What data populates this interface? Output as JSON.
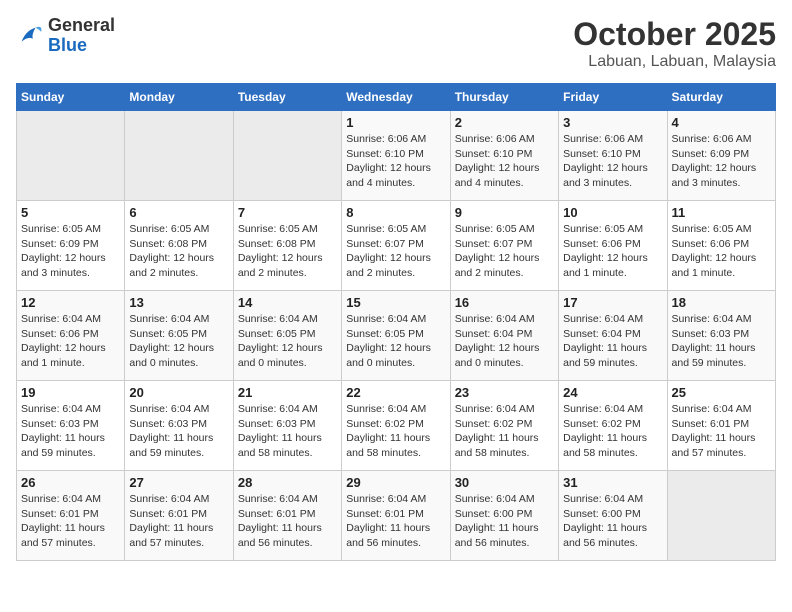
{
  "header": {
    "logo_general": "General",
    "logo_blue": "Blue",
    "month": "October 2025",
    "location": "Labuan, Labuan, Malaysia"
  },
  "days_of_week": [
    "Sunday",
    "Monday",
    "Tuesday",
    "Wednesday",
    "Thursday",
    "Friday",
    "Saturday"
  ],
  "weeks": [
    [
      {
        "day": "",
        "info": ""
      },
      {
        "day": "",
        "info": ""
      },
      {
        "day": "",
        "info": ""
      },
      {
        "day": "1",
        "info": "Sunrise: 6:06 AM\nSunset: 6:10 PM\nDaylight: 12 hours\nand 4 minutes."
      },
      {
        "day": "2",
        "info": "Sunrise: 6:06 AM\nSunset: 6:10 PM\nDaylight: 12 hours\nand 4 minutes."
      },
      {
        "day": "3",
        "info": "Sunrise: 6:06 AM\nSunset: 6:10 PM\nDaylight: 12 hours\nand 3 minutes."
      },
      {
        "day": "4",
        "info": "Sunrise: 6:06 AM\nSunset: 6:09 PM\nDaylight: 12 hours\nand 3 minutes."
      }
    ],
    [
      {
        "day": "5",
        "info": "Sunrise: 6:05 AM\nSunset: 6:09 PM\nDaylight: 12 hours\nand 3 minutes."
      },
      {
        "day": "6",
        "info": "Sunrise: 6:05 AM\nSunset: 6:08 PM\nDaylight: 12 hours\nand 2 minutes."
      },
      {
        "day": "7",
        "info": "Sunrise: 6:05 AM\nSunset: 6:08 PM\nDaylight: 12 hours\nand 2 minutes."
      },
      {
        "day": "8",
        "info": "Sunrise: 6:05 AM\nSunset: 6:07 PM\nDaylight: 12 hours\nand 2 minutes."
      },
      {
        "day": "9",
        "info": "Sunrise: 6:05 AM\nSunset: 6:07 PM\nDaylight: 12 hours\nand 2 minutes."
      },
      {
        "day": "10",
        "info": "Sunrise: 6:05 AM\nSunset: 6:06 PM\nDaylight: 12 hours\nand 1 minute."
      },
      {
        "day": "11",
        "info": "Sunrise: 6:05 AM\nSunset: 6:06 PM\nDaylight: 12 hours\nand 1 minute."
      }
    ],
    [
      {
        "day": "12",
        "info": "Sunrise: 6:04 AM\nSunset: 6:06 PM\nDaylight: 12 hours\nand 1 minute."
      },
      {
        "day": "13",
        "info": "Sunrise: 6:04 AM\nSunset: 6:05 PM\nDaylight: 12 hours\nand 0 minutes."
      },
      {
        "day": "14",
        "info": "Sunrise: 6:04 AM\nSunset: 6:05 PM\nDaylight: 12 hours\nand 0 minutes."
      },
      {
        "day": "15",
        "info": "Sunrise: 6:04 AM\nSunset: 6:05 PM\nDaylight: 12 hours\nand 0 minutes."
      },
      {
        "day": "16",
        "info": "Sunrise: 6:04 AM\nSunset: 6:04 PM\nDaylight: 12 hours\nand 0 minutes."
      },
      {
        "day": "17",
        "info": "Sunrise: 6:04 AM\nSunset: 6:04 PM\nDaylight: 11 hours\nand 59 minutes."
      },
      {
        "day": "18",
        "info": "Sunrise: 6:04 AM\nSunset: 6:03 PM\nDaylight: 11 hours\nand 59 minutes."
      }
    ],
    [
      {
        "day": "19",
        "info": "Sunrise: 6:04 AM\nSunset: 6:03 PM\nDaylight: 11 hours\nand 59 minutes."
      },
      {
        "day": "20",
        "info": "Sunrise: 6:04 AM\nSunset: 6:03 PM\nDaylight: 11 hours\nand 59 minutes."
      },
      {
        "day": "21",
        "info": "Sunrise: 6:04 AM\nSunset: 6:03 PM\nDaylight: 11 hours\nand 58 minutes."
      },
      {
        "day": "22",
        "info": "Sunrise: 6:04 AM\nSunset: 6:02 PM\nDaylight: 11 hours\nand 58 minutes."
      },
      {
        "day": "23",
        "info": "Sunrise: 6:04 AM\nSunset: 6:02 PM\nDaylight: 11 hours\nand 58 minutes."
      },
      {
        "day": "24",
        "info": "Sunrise: 6:04 AM\nSunset: 6:02 PM\nDaylight: 11 hours\nand 58 minutes."
      },
      {
        "day": "25",
        "info": "Sunrise: 6:04 AM\nSunset: 6:01 PM\nDaylight: 11 hours\nand 57 minutes."
      }
    ],
    [
      {
        "day": "26",
        "info": "Sunrise: 6:04 AM\nSunset: 6:01 PM\nDaylight: 11 hours\nand 57 minutes."
      },
      {
        "day": "27",
        "info": "Sunrise: 6:04 AM\nSunset: 6:01 PM\nDaylight: 11 hours\nand 57 minutes."
      },
      {
        "day": "28",
        "info": "Sunrise: 6:04 AM\nSunset: 6:01 PM\nDaylight: 11 hours\nand 56 minutes."
      },
      {
        "day": "29",
        "info": "Sunrise: 6:04 AM\nSunset: 6:01 PM\nDaylight: 11 hours\nand 56 minutes."
      },
      {
        "day": "30",
        "info": "Sunrise: 6:04 AM\nSunset: 6:00 PM\nDaylight: 11 hours\nand 56 minutes."
      },
      {
        "day": "31",
        "info": "Sunrise: 6:04 AM\nSunset: 6:00 PM\nDaylight: 11 hours\nand 56 minutes."
      },
      {
        "day": "",
        "info": ""
      }
    ]
  ]
}
